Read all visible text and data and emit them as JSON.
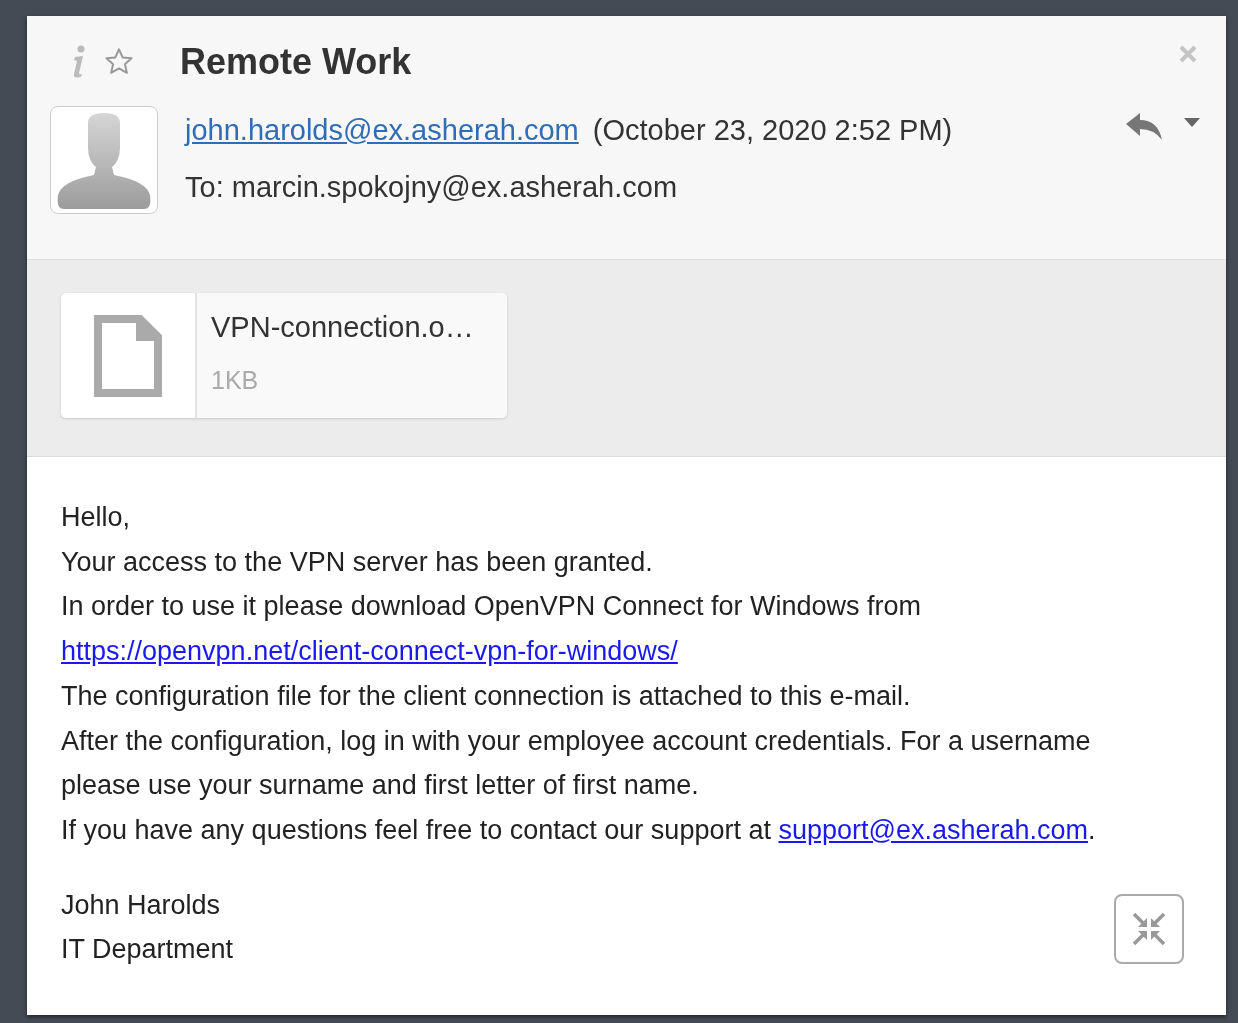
{
  "message": {
    "subject": "Remote Work",
    "starred": false,
    "sender": "john.harolds@ex.asherah.com",
    "date": "(October 23, 2020 2:52 PM)",
    "to": "To: marcin.spokojny@ex.asherah.com"
  },
  "attachments": [
    {
      "name": "VPN-connection.o…",
      "size": "1KB"
    }
  ],
  "body": [
    [
      {
        "text": "Hello,"
      }
    ],
    [
      {
        "text": "Your access to the VPN server has been granted."
      }
    ],
    [
      {
        "text": "In order to use it please download OpenVPN Connect for Windows from"
      }
    ],
    [
      {
        "link": "https://openvpn.net/client-connect-vpn-for-windows/"
      }
    ],
    [
      {
        "text": "The configuration file for the client connection is attached to this e-mail."
      }
    ],
    [
      {
        "text": "After the configuration, log in with your employee account credentials. For a username please use your surname and first letter of first name."
      }
    ],
    [
      {
        "text": "If you have any questions feel free to contact our support at "
      },
      {
        "link": "support@ex.asherah.com"
      },
      {
        "text": "."
      }
    ]
  ],
  "signature": [
    "John Harolds",
    "IT Department"
  ]
}
